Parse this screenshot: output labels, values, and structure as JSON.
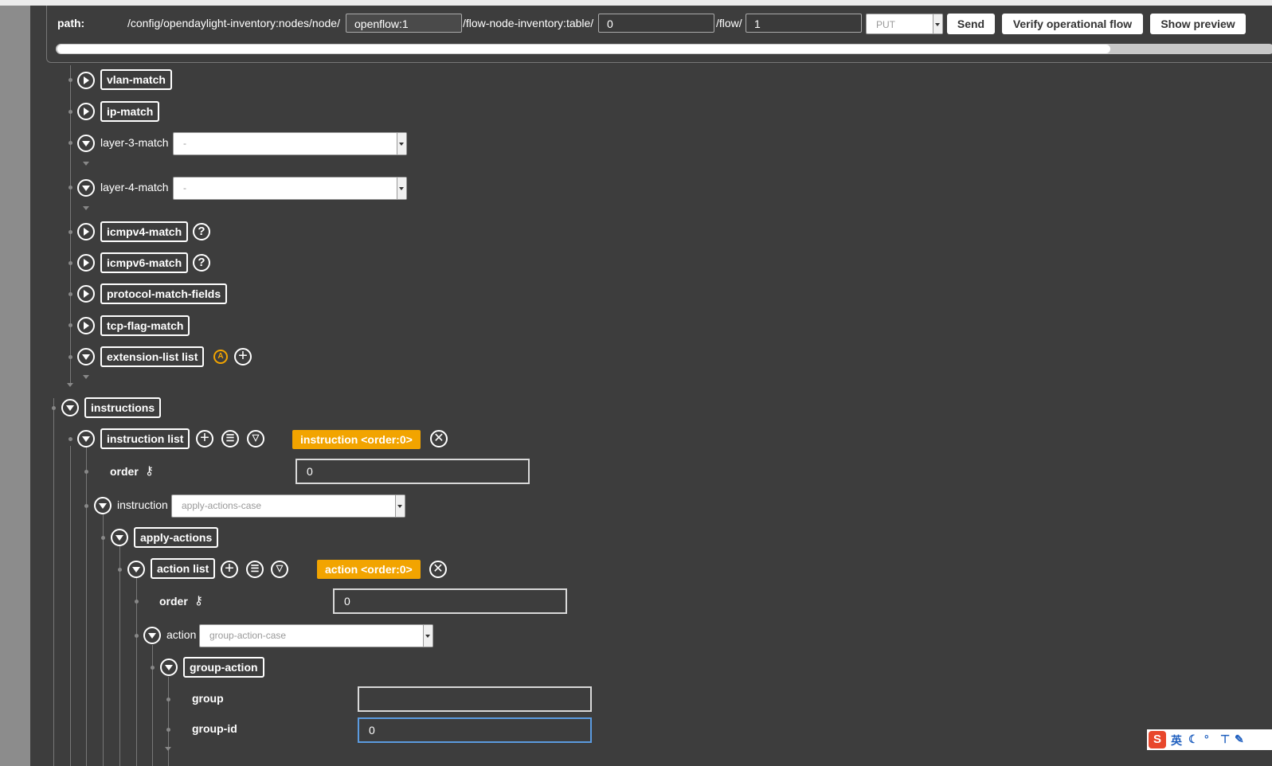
{
  "path_bar": {
    "label": "path:",
    "segment1": "/config/opendaylight-inventory:nodes/node/",
    "node_id": "openflow:1",
    "segment2": "/flow-node-inventory:table/",
    "table_id": "0",
    "segment3": "/flow/",
    "flow_id": "1",
    "method": "PUT",
    "send": "Send",
    "verify": "Verify operational flow",
    "preview": "Show preview"
  },
  "tree": {
    "vlan_match": "vlan-match",
    "ip_match": "ip-match",
    "layer3": {
      "label": "layer-3-match",
      "value": "-"
    },
    "layer4": {
      "label": "layer-4-match",
      "value": "-"
    },
    "icmpv4": "icmpv4-match",
    "icmpv6": "icmpv6-match",
    "protocol_match": "protocol-match-fields",
    "tcp_flag": "tcp-flag-match",
    "extension_list": "extension-list list",
    "help_glyph": "?",
    "augment_glyph": "A",
    "instructions": "instructions",
    "instruction_list": "instruction list",
    "instruction_tag": "instruction  <order:0>",
    "order_label": "order",
    "instruction_order_value": "0",
    "instruction_select": {
      "label": "instruction",
      "value": "apply-actions-case"
    },
    "apply_actions": "apply-actions",
    "action_list": "action list",
    "action_tag": "action  <order:0>",
    "action_order_value": "0",
    "action_select": {
      "label": "action",
      "value": "group-action-case"
    },
    "group_action": "group-action",
    "group_label": "group",
    "group_value": "",
    "group_id_label": "group-id",
    "group_id_value": "0"
  },
  "tray": {
    "ime": "英"
  },
  "colors": {
    "background": "#3d3d3d",
    "accent": "#f2a400",
    "focus": "#5b9be0"
  }
}
